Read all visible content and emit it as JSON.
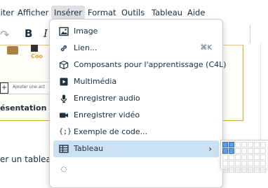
{
  "menubar": {
    "items": [
      "Editer",
      "Afficher",
      "Insérer",
      "Format",
      "Outils",
      "Tableau",
      "Aide"
    ],
    "active_index": 2
  },
  "toolbar": {
    "undo_icon": "redo-arrow-icon",
    "bold": "B",
    "italic": "I"
  },
  "editor": {
    "card_subtitle": "Coo",
    "add_label": "Ajouter une act",
    "add_plus": "+",
    "presentation": "ésentation",
    "body_text": "er un tableau"
  },
  "menu": {
    "items": [
      {
        "label": "Image",
        "icon": "image-icon",
        "shortcut": ""
      },
      {
        "label": "Lien...",
        "icon": "link-icon",
        "shortcut": "⌘K"
      },
      {
        "label": "Composants pour l'apprentissage (C4L)",
        "icon": "cube-icon",
        "shortcut": ""
      },
      {
        "label": "Multimédia",
        "icon": "media-play-icon",
        "shortcut": ""
      },
      {
        "label": "Enregistrer audio",
        "icon": "microphone-icon",
        "shortcut": ""
      },
      {
        "label": "Enregistrer vidéo",
        "icon": "video-camera-icon",
        "shortcut": ""
      },
      {
        "label": "Exemple de code...",
        "icon": "code-sample-icon",
        "shortcut": ""
      },
      {
        "label": "Tableau",
        "icon": "table-icon",
        "shortcut": "",
        "submenu": true,
        "highlighted": true
      }
    ],
    "chevron": "›"
  },
  "colors": {
    "menu_highlight": "#cce0f5",
    "menubar_active": "#dee0e2",
    "card_border": "#d9a233",
    "grid_selected": "#5da0e6"
  }
}
